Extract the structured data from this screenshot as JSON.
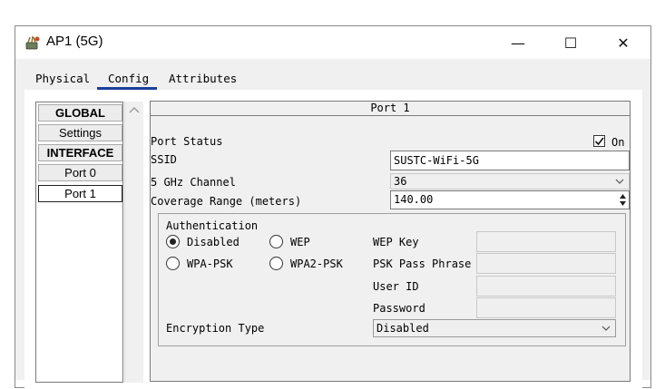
{
  "window": {
    "title": "AP1 (5G)",
    "app_icon": "router-icon",
    "controls": {
      "minimize": "—",
      "maximize": "☐",
      "close": "✕"
    }
  },
  "tabs": [
    {
      "label": "Physical",
      "active": false
    },
    {
      "label": "Config",
      "active": true
    },
    {
      "label": "Attributes",
      "active": false
    }
  ],
  "sidebar": {
    "items": [
      {
        "label": "GLOBAL",
        "type": "header"
      },
      {
        "label": "Settings",
        "type": "item"
      },
      {
        "label": "INTERFACE",
        "type": "header"
      },
      {
        "label": "Port 0",
        "type": "item"
      },
      {
        "label": "Port 1",
        "type": "item",
        "selected": true
      }
    ]
  },
  "port": {
    "title": "Port 1",
    "status_label": "Port Status",
    "status_on_label": "On",
    "status_on": true,
    "ssid_label": "SSID",
    "ssid_value": "SUSTC-WiFi-5G",
    "channel_label": "5 GHz Channel",
    "channel_value": "36",
    "coverage_label": "Coverage Range (meters)",
    "coverage_value": "140.00"
  },
  "auth": {
    "title": "Authentication",
    "options": [
      {
        "label": "Disabled",
        "selected": true
      },
      {
        "label": "WEP",
        "selected": false
      },
      {
        "label": "WPA-PSK",
        "selected": false
      },
      {
        "label": "WPA2-PSK",
        "selected": false
      }
    ],
    "wep_key_label": "WEP Key",
    "psk_label": "PSK Pass Phrase",
    "user_id_label": "User ID",
    "password_label": "Password",
    "encryption_label": "Encryption Type",
    "encryption_value": "Disabled"
  },
  "colors": {
    "tab_accent": "#1c3f9c",
    "panel_bg": "#f0f0f0"
  }
}
